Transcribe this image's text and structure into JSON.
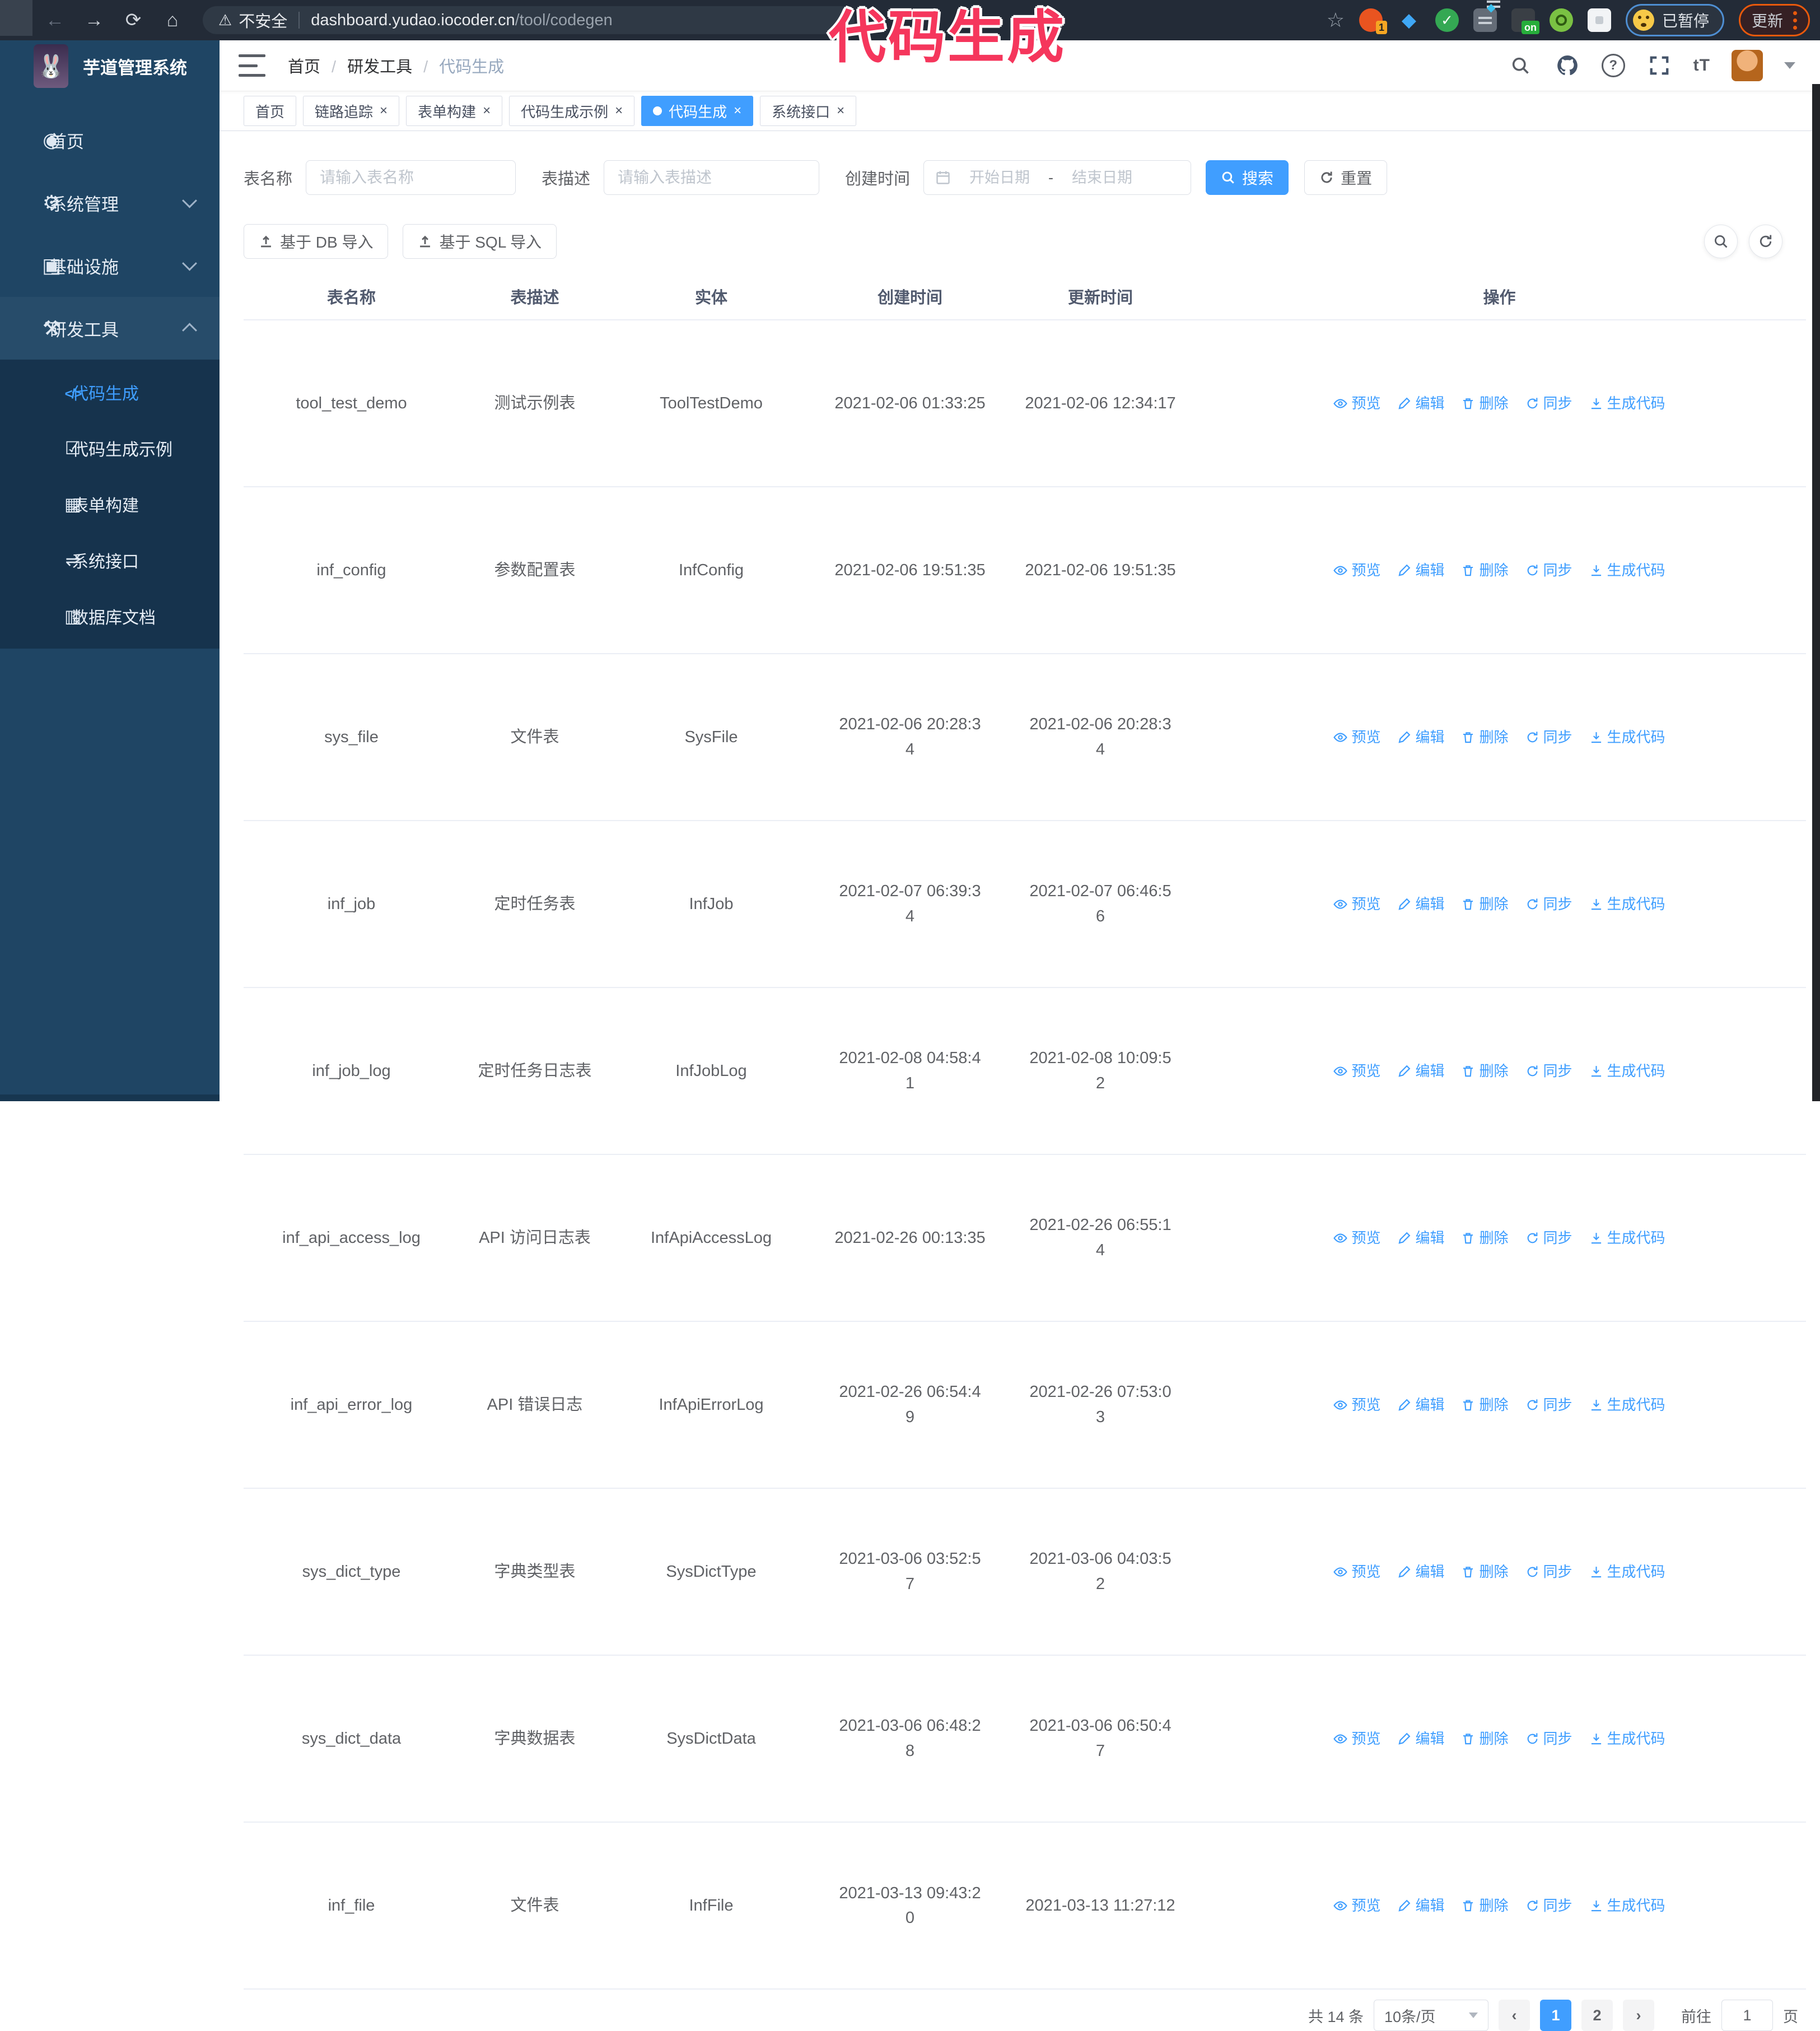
{
  "browser": {
    "security_label": "不安全",
    "url_host": "dashboard.yudao.iocoder.cn",
    "url_path": "/tool/codegen",
    "ext_badge_1": "1",
    "ext_badge_on": "on",
    "paused_badge": "已暂停",
    "update_button": "更新"
  },
  "annotation": {
    "text": "代码生成",
    "color": "#f5365c"
  },
  "sidebar": {
    "logo_title": "芋道管理系统",
    "items": [
      {
        "label": "首页",
        "icon": "dashboard-icon",
        "has_children": false,
        "expanded": false
      },
      {
        "label": "系统管理",
        "icon": "gear-icon",
        "has_children": true,
        "expanded": false
      },
      {
        "label": "基础设施",
        "icon": "monitor-icon",
        "has_children": true,
        "expanded": false
      },
      {
        "label": "研发工具",
        "icon": "toolbox-icon",
        "has_children": true,
        "expanded": true
      }
    ],
    "submenu": [
      {
        "label": "代码生成",
        "icon": "code-icon",
        "active": true
      },
      {
        "label": "代码生成示例",
        "icon": "example-icon",
        "active": false
      },
      {
        "label": "表单构建",
        "icon": "form-icon",
        "active": false
      },
      {
        "label": "系统接口",
        "icon": "api-icon",
        "active": false
      },
      {
        "label": "数据库文档",
        "icon": "database-doc-icon",
        "active": false
      }
    ]
  },
  "header": {
    "breadcrumb": [
      {
        "label": "首页"
      },
      {
        "label": "研发工具"
      },
      {
        "label": "代码生成"
      }
    ],
    "font_size_tool": "tT"
  },
  "tabs": [
    {
      "label": "首页",
      "closable": false,
      "active": false
    },
    {
      "label": "链路追踪",
      "closable": true,
      "active": false
    },
    {
      "label": "表单构建",
      "closable": true,
      "active": false
    },
    {
      "label": "代码生成示例",
      "closable": true,
      "active": false
    },
    {
      "label": "代码生成",
      "closable": true,
      "active": true
    },
    {
      "label": "系统接口",
      "closable": true,
      "active": false
    }
  ],
  "filters": {
    "table_name_label": "表名称",
    "table_name_placeholder": "请输入表名称",
    "table_desc_label": "表描述",
    "table_desc_placeholder": "请输入表描述",
    "create_time_label": "创建时间",
    "date_start_placeholder": "开始日期",
    "date_separator": "-",
    "date_end_placeholder": "结束日期",
    "search_label": "搜索",
    "reset_label": "重置"
  },
  "toolbar": {
    "import_db_label": "基于 DB 导入",
    "import_sql_label": "基于 SQL 导入"
  },
  "table": {
    "columns": [
      "表名称",
      "表描述",
      "实体",
      "创建时间",
      "更新时间",
      "操作"
    ],
    "actions": [
      "预览",
      "编辑",
      "删除",
      "同步",
      "生成代码"
    ],
    "rows": [
      {
        "name": "tool_test_demo",
        "desc": "测试示例表",
        "entity": "ToolTestDemo",
        "create_time": "2021-02-06 01:33:25",
        "update_time": "2021-02-06 12:34:17"
      },
      {
        "name": "inf_config",
        "desc": "参数配置表",
        "entity": "InfConfig",
        "create_time": "2021-02-06 19:51:35",
        "update_time": "2021-02-06 19:51:35"
      },
      {
        "name": "sys_file",
        "desc": "文件表",
        "entity": "SysFile",
        "create_time": "2021-02-06 20:28:3\n4",
        "update_time": "2021-02-06 20:28:3\n4"
      },
      {
        "name": "inf_job",
        "desc": "定时任务表",
        "entity": "InfJob",
        "create_time": "2021-02-07 06:39:3\n4",
        "update_time": "2021-02-07 06:46:5\n6"
      },
      {
        "name": "inf_job_log",
        "desc": "定时任务日志表",
        "entity": "InfJobLog",
        "create_time": "2021-02-08 04:58:4\n1",
        "update_time": "2021-02-08 10:09:5\n2"
      },
      {
        "name": "inf_api_access_log",
        "desc": "API 访问日志表",
        "entity": "InfApiAccessLog",
        "create_time": "2021-02-26 00:13:35",
        "update_time": "2021-02-26 06:55:1\n4"
      },
      {
        "name": "inf_api_error_log",
        "desc": "API 错误日志",
        "entity": "InfApiErrorLog",
        "create_time": "2021-02-26 06:54:4\n9",
        "update_time": "2021-02-26 07:53:0\n3"
      },
      {
        "name": "sys_dict_type",
        "desc": "字典类型表",
        "entity": "SysDictType",
        "create_time": "2021-03-06 03:52:5\n7",
        "update_time": "2021-03-06 04:03:5\n2"
      },
      {
        "name": "sys_dict_data",
        "desc": "字典数据表",
        "entity": "SysDictData",
        "create_time": "2021-03-06 06:48:2\n8",
        "update_time": "2021-03-06 06:50:4\n7"
      },
      {
        "name": "inf_file",
        "desc": "文件表",
        "entity": "InfFile",
        "create_time": "2021-03-13 09:43:2\n0",
        "update_time": "2021-03-13 11:27:12"
      }
    ]
  },
  "pagination": {
    "total_label": "共 14 条",
    "page_size": "10条/页",
    "prev": "‹",
    "next": "›",
    "pages": [
      {
        "label": "1",
        "active": true
      },
      {
        "label": "2",
        "active": false
      }
    ],
    "goto_label": "前往",
    "goto_value": "1",
    "page_unit": "页"
  }
}
